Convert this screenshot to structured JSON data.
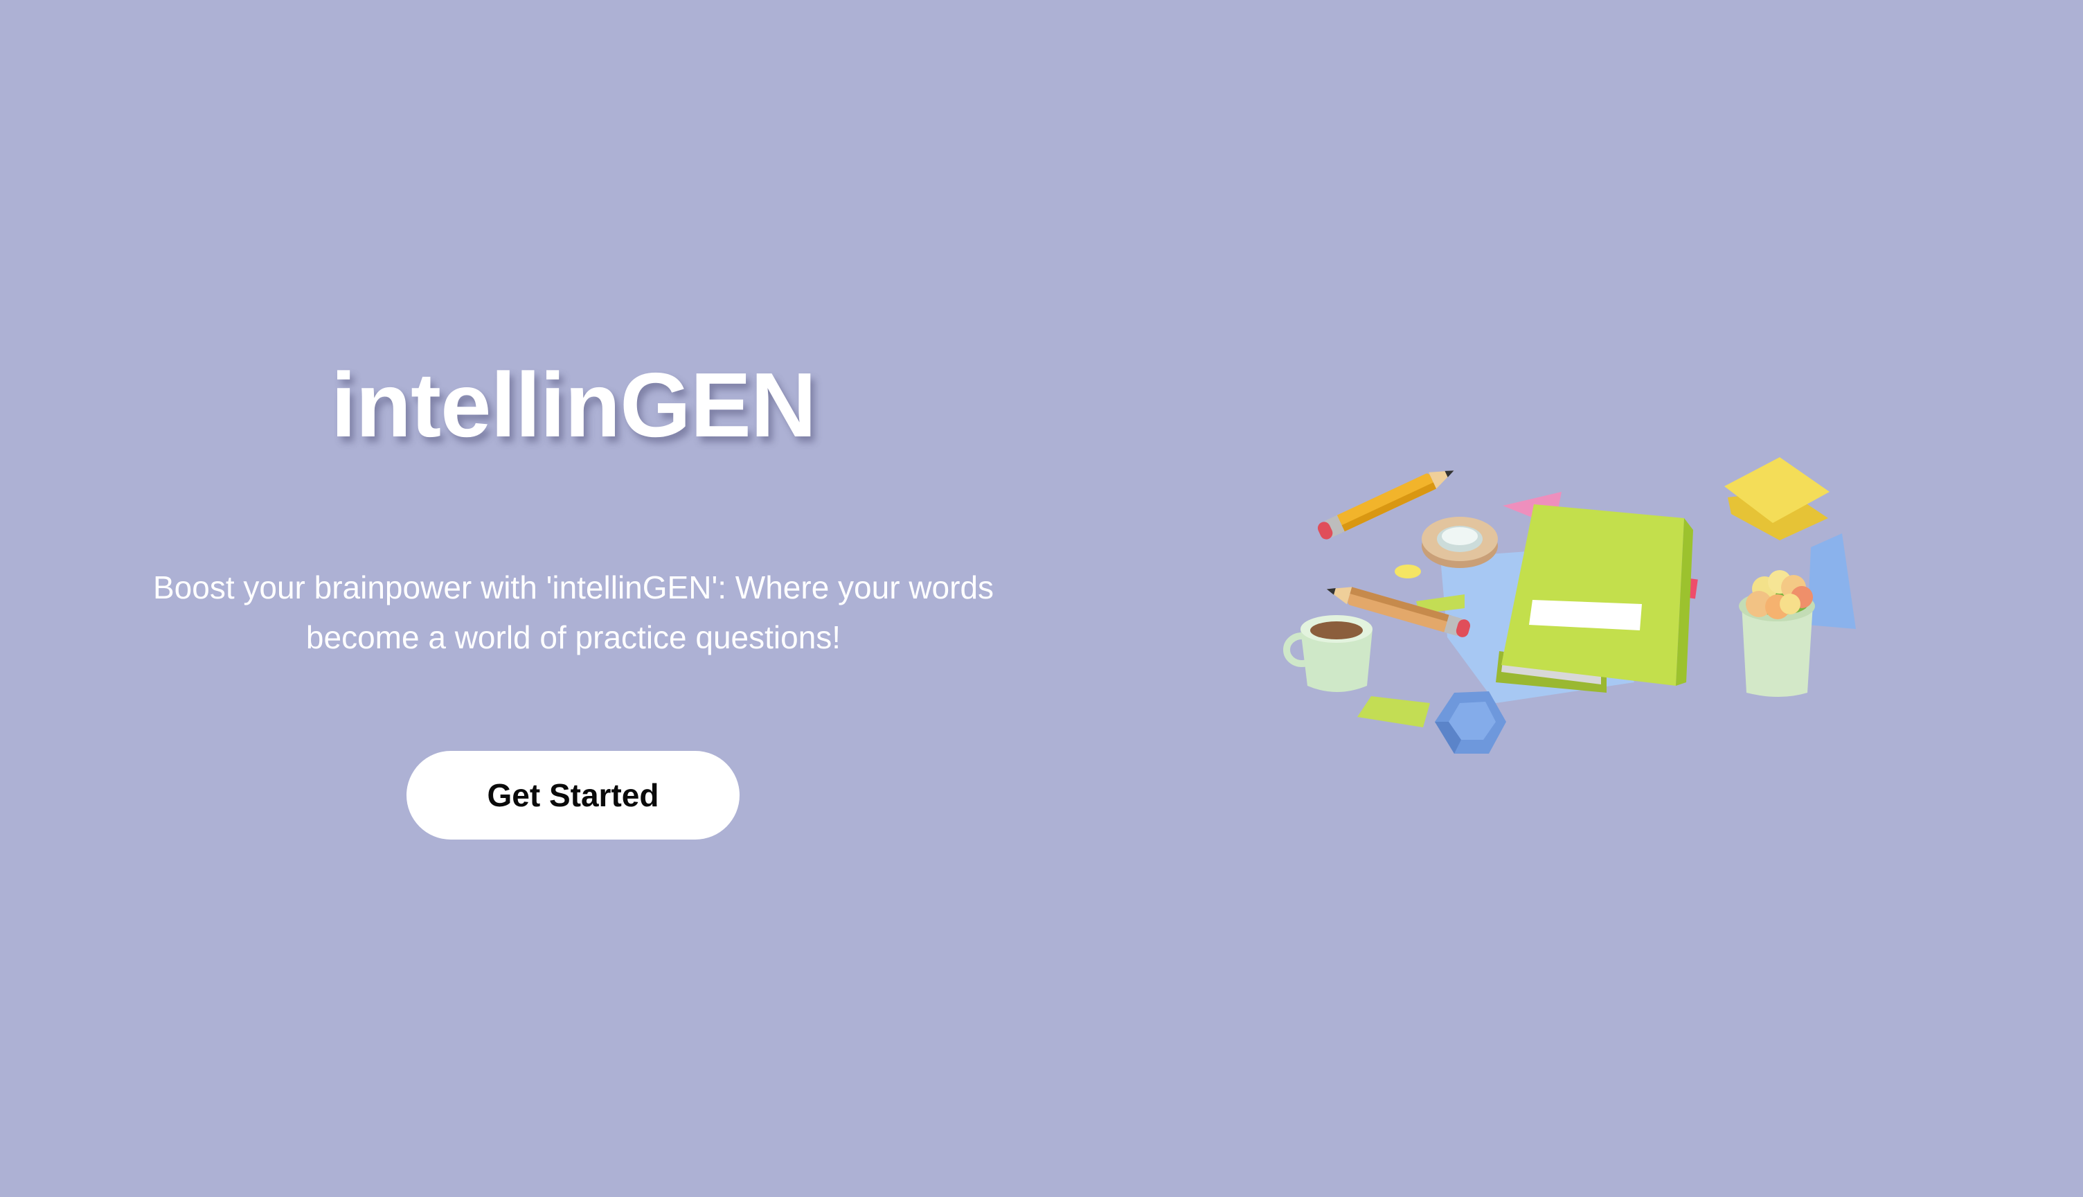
{
  "hero": {
    "title": "intellinGEN",
    "tagline": "Boost your brainpower with 'intellinGEN': Where your words become a world of practice questions!",
    "cta_label": "Get Started"
  },
  "illustration": {
    "icon": "study-supplies-illustration"
  },
  "colors": {
    "background": "#adb1d4",
    "title": "#ffffff",
    "button_bg": "#ffffff",
    "button_text": "#0a0a0a"
  }
}
